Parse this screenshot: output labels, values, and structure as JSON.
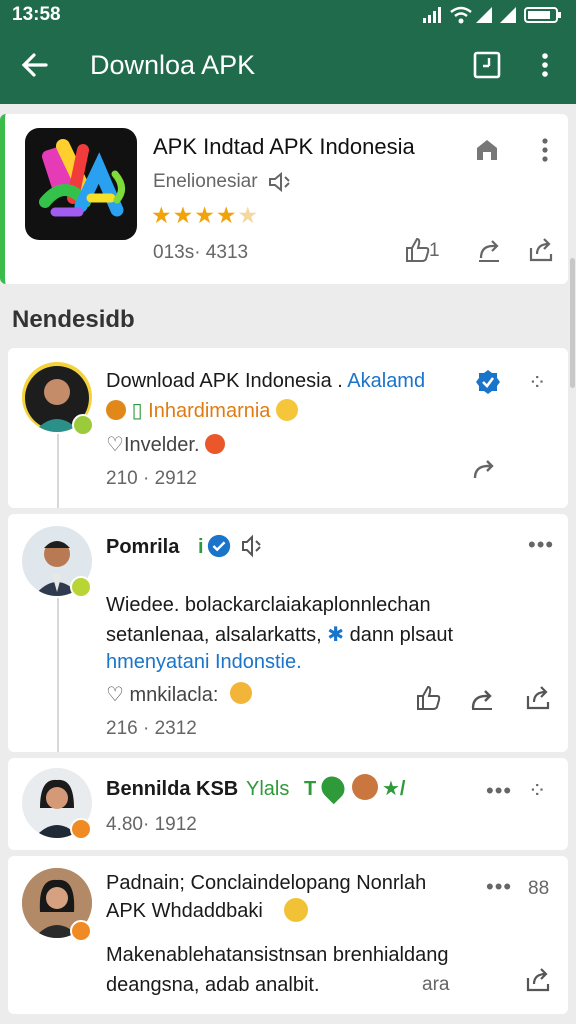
{
  "status_bar": {
    "time": "13:58"
  },
  "toolbar": {
    "title": "Downloa APK"
  },
  "app": {
    "name": "APK Indtad APK Indonesia",
    "developer": "Enelionesiar",
    "rating": 4.5,
    "stats": "013s· 4313",
    "action_count": "1"
  },
  "section": {
    "title": "Nendesidb"
  },
  "posts": [
    {
      "line1": "Download APK Indonesia . ",
      "line1_link": "Akalamd",
      "line2": "Inhardimarnia",
      "line3": "Invelder.",
      "meta": "210 · 2912"
    },
    {
      "name": "Pomrila",
      "body1": "Wiedee. bolackarclaiakaplonnlechan",
      "body2": "setanlenaa, alsalarkatts,",
      "body2b": "dann plsaut",
      "body3": "hmenyatani Indonstie.",
      "like_label": "mnkilacla:",
      "meta": "216 · 2312"
    },
    {
      "name": "Bennilda KSB",
      "tag": "Ylals",
      "tag2": "T",
      "meta": "4.80· 1912"
    },
    {
      "line1": "Padnain; Conclaindelopang Nonrlah",
      "line2": "APK Whdaddbaki",
      "body1": "Makenablehatansistnsan brenhialdang",
      "body2": "deangsna, adab analbit.",
      "side_label": "ara",
      "count": "88"
    }
  ],
  "colors": {
    "app_bar": "#1f6b4c",
    "accent_green": "#3dbb4a",
    "link_blue": "#1a74c9",
    "star": "#f0a30a"
  }
}
